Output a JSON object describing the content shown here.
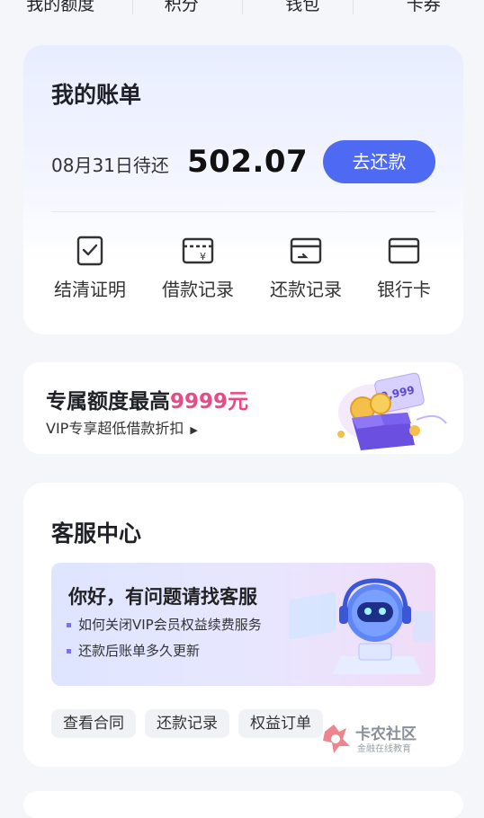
{
  "top_nav": [
    "我的额度",
    "积分",
    "钱包",
    "卡券"
  ],
  "bill": {
    "title": "我的账单",
    "due_label": "08月31日待还",
    "amount": "502.07",
    "repay_button": "去还款",
    "actions": [
      {
        "label": "结清证明",
        "icon": "certificate-icon"
      },
      {
        "label": "借款记录",
        "icon": "loan-record-icon"
      },
      {
        "label": "还款记录",
        "icon": "repay-record-icon"
      },
      {
        "label": "银行卡",
        "icon": "bank-card-icon"
      }
    ]
  },
  "promo": {
    "headline_prefix": "专属额度最高",
    "headline_highlight": "9999元",
    "subtitle": "VIP专享超低借款折扣",
    "ticket_value": "9,999"
  },
  "service": {
    "title": "客服中心",
    "banner_title": "你好，有问题请找客服",
    "faqs": [
      "如何关闭VIP会员权益续费服务",
      "还款后账单多久更新"
    ],
    "chips": [
      "查看合同",
      "还款记录",
      "权益订单"
    ]
  },
  "watermark": {
    "name": "卡农社区",
    "tagline": "金融在线教育"
  },
  "colors": {
    "accent": "#4e6af3",
    "highlight": "#e84a86"
  }
}
